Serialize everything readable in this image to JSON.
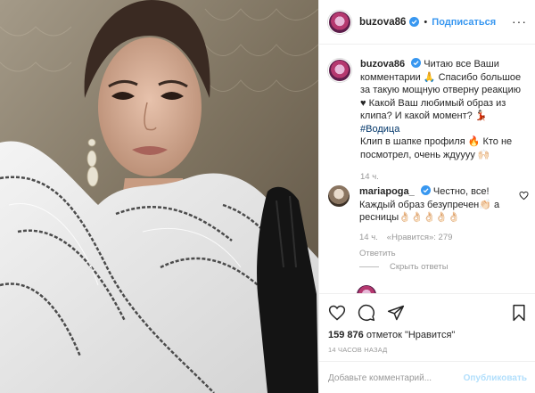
{
  "photo": {
    "alt_icon": "portrait-photo"
  },
  "header": {
    "username": "buzova86",
    "separator": "•",
    "follow_label": "Подписаться",
    "more_icon": "ellipsis-icon"
  },
  "caption": {
    "username": "buzova86",
    "text1": "Читаю все Ваши комментарии 🙏 Спасибо большое за такую мощную отверну реакцию ♥ Какой Ваш любимый образ из клипа? И какой момент? 💃🏻",
    "hashtag": "#Водица",
    "text2": "Клип в шапке профиля 🔥 Кто не посмотрел, очень ждуууу 🙌🏻",
    "time": "14 ч."
  },
  "comment": {
    "username": "mariapoga_",
    "text": "Честно, все! Каждый образ безупречен👏🏻 а ресницы👌🏻👌🏻👌🏻👌🏻👌🏻",
    "time": "14 ч.",
    "likes": "«Нравится»: 279",
    "reply": "Ответить",
    "hide_replies": "Скрыть ответы"
  },
  "actions": {
    "likes_count": "159 876",
    "likes_text": "отметок \"Нравится\"",
    "time": "14 ЧАСОВ НАЗАД"
  },
  "add_comment": {
    "placeholder": "Добавьте комментарий...",
    "publish_label": "Опубликовать"
  },
  "colors": {
    "accent": "#3897f0",
    "muted": "#999999",
    "border": "#efefef",
    "hashtag": "#003569"
  }
}
